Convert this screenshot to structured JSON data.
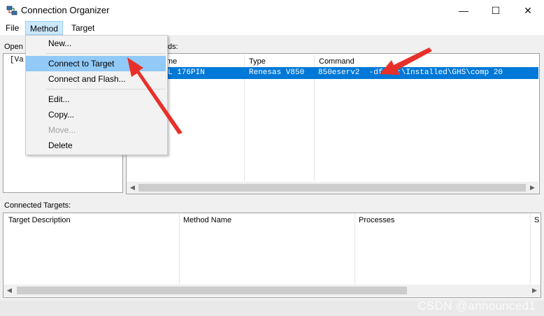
{
  "window": {
    "title": "Connection Organizer",
    "controls": {
      "minimize": "—",
      "maximize": "☐",
      "close": "✕"
    }
  },
  "menubar": {
    "file": "File",
    "method": "Method",
    "target": "Target"
  },
  "left_pane": {
    "label": "Open",
    "tree_item": "[Va"
  },
  "methods_pane": {
    "label_suffix": "ds:",
    "columns": {
      "name": "me",
      "type": "Type",
      "command": "Command"
    },
    "rows": [
      {
        "name": "L 176PIN",
        "type": "Renesas V850",
        "command": "850eserv2  -df=\"D:\\Installed\\GHS\\comp 20"
      }
    ]
  },
  "connected": {
    "label": "Connected Targets:",
    "columns": {
      "description": "Target Description",
      "method": "Method Name",
      "processes": "Processes",
      "extra": "S"
    }
  },
  "dropdown": {
    "items": [
      {
        "label": "New...",
        "state": "normal"
      },
      {
        "label": "Connect to Target",
        "state": "highlighted"
      },
      {
        "label": "Connect and Flash...",
        "state": "normal"
      },
      {
        "label": "Edit...",
        "state": "normal"
      },
      {
        "label": "Copy...",
        "state": "normal"
      },
      {
        "label": "Move...",
        "state": "disabled"
      },
      {
        "label": "Delete",
        "state": "normal"
      }
    ]
  },
  "colors": {
    "selection": "#0078d7",
    "menu_highlight": "#91c9f7",
    "annotation_arrow": "#e8302a"
  },
  "watermark": "CSDN @announced1"
}
